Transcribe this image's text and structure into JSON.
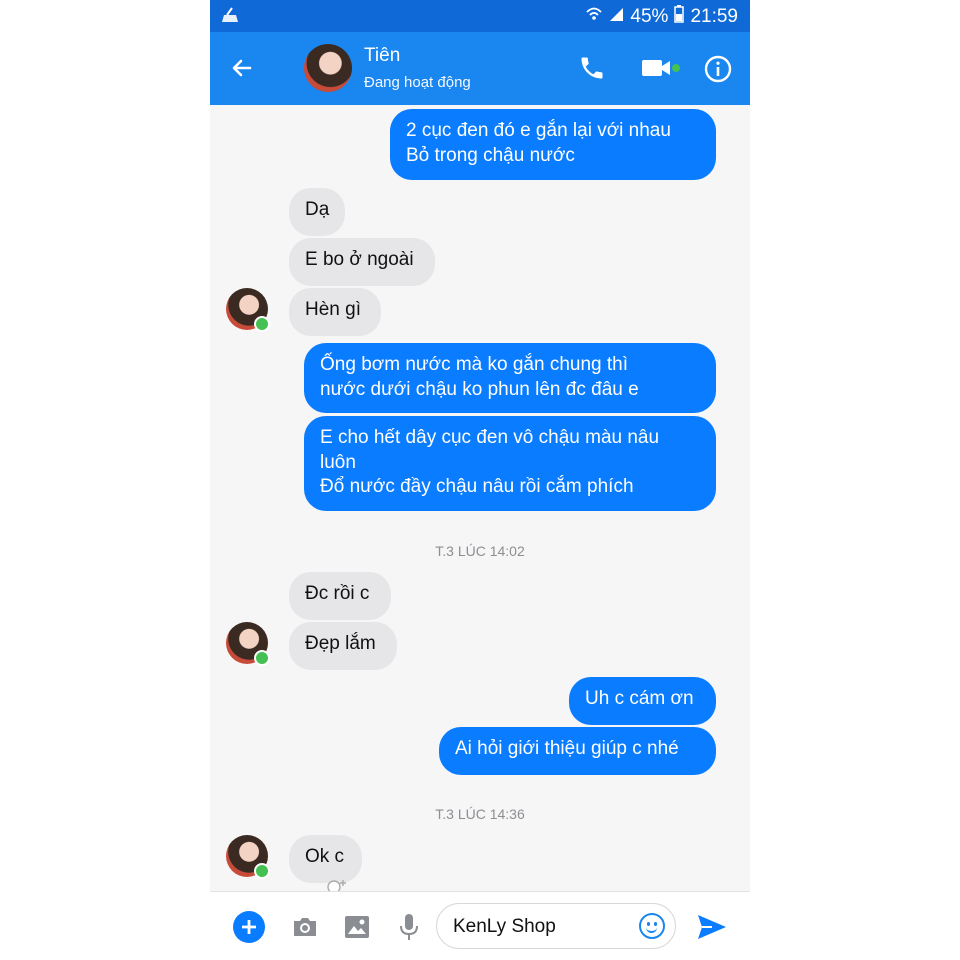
{
  "status": {
    "battery": "45%",
    "time": "21:59"
  },
  "header": {
    "name": "Tiên",
    "subtitle": "Đang hoạt động"
  },
  "messages": [
    {
      "text": "2 cục đen đó e gắn lại với nhau\nBỏ trong chậu nước"
    },
    {
      "text": "Dạ"
    },
    {
      "text": "E bo ở ngoài"
    },
    {
      "text": "Hèn gì"
    },
    {
      "text": "Ống bơm nước mà ko gắn chung thì\nnước dưới chậu ko phun lên đc đâu e"
    },
    {
      "text": "E cho hết dây cục đen vô chậu màu nâu\nluôn\nĐổ nước đầy chậu nâu rồi cắm phích"
    },
    {
      "text": "Đc rồi c"
    },
    {
      "text": "Đẹp lắm"
    },
    {
      "text": "Uh c cám ơn"
    },
    {
      "text": "Ai hỏi giới thiệu giúp c nhé"
    },
    {
      "text": "Ok c"
    }
  ],
  "timestamps": [
    "T.3 LÚC 14:02",
    "T.3 LÚC 14:36"
  ],
  "composer": {
    "text": "KenLy Shop"
  },
  "colors": {
    "appbar": "#1a86f0",
    "statusbar": "#0f6ad8",
    "outgoing": "#0a7cff",
    "incoming": "#e6e6e9",
    "online": "#44c152"
  },
  "icons": [
    "back-arrow-icon",
    "phone-icon",
    "video-camera-icon",
    "info-icon",
    "add-icon",
    "camera-icon",
    "image-icon",
    "microphone-icon",
    "emoji-icon",
    "send-icon"
  ]
}
